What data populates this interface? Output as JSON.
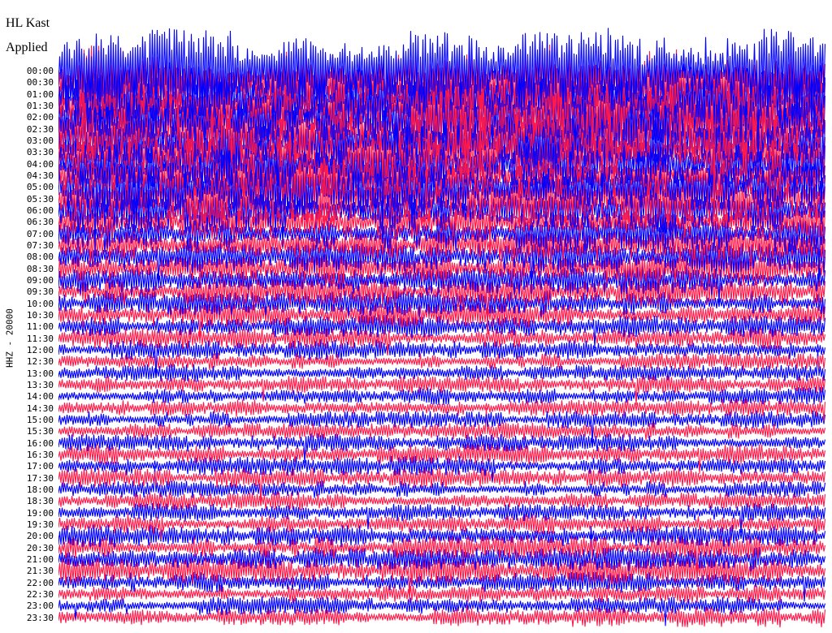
{
  "header": {
    "station": "HL Kast",
    "status": "Applied"
  },
  "channel": {
    "label": "HHZ - 20000"
  },
  "chart_data": {
    "type": "line",
    "kind": "helicorder",
    "rows": [
      "00:00",
      "00:30",
      "01:00",
      "01:30",
      "02:00",
      "02:30",
      "03:00",
      "03:30",
      "04:00",
      "04:30",
      "05:00",
      "05:30",
      "06:00",
      "06:30",
      "07:00",
      "07:30",
      "08:00",
      "08:30",
      "09:00",
      "09:30",
      "10:00",
      "10:30",
      "11:00",
      "11:30",
      "12:00",
      "12:30",
      "13:00",
      "13:30",
      "14:00",
      "14:30",
      "15:00",
      "15:30",
      "16:00",
      "16:30",
      "17:00",
      "17:30",
      "18:00",
      "18:30",
      "19:00",
      "19:30",
      "20:00",
      "20:30",
      "21:00",
      "21:30",
      "22:00",
      "22:30",
      "23:00",
      "23:30"
    ],
    "row_colors": [
      "#0000ff",
      "#ff1a4a"
    ],
    "amplitude_by_row": [
      3.2,
      3.0,
      2.8,
      2.9,
      2.7,
      2.6,
      2.5,
      2.4,
      2.2,
      2.1,
      2.4,
      2.3,
      1.9,
      1.4,
      1.5,
      1.4,
      1.3,
      1.3,
      1.2,
      1.2,
      1.1,
      1.0,
      0.9,
      0.9,
      0.8,
      0.7,
      0.7,
      0.7,
      0.7,
      0.7,
      0.7,
      0.7,
      0.7,
      0.8,
      0.8,
      0.8,
      0.7,
      0.7,
      0.7,
      0.8,
      0.9,
      1.0,
      1.0,
      1.1,
      0.8,
      0.7,
      0.7,
      0.8
    ]
  }
}
